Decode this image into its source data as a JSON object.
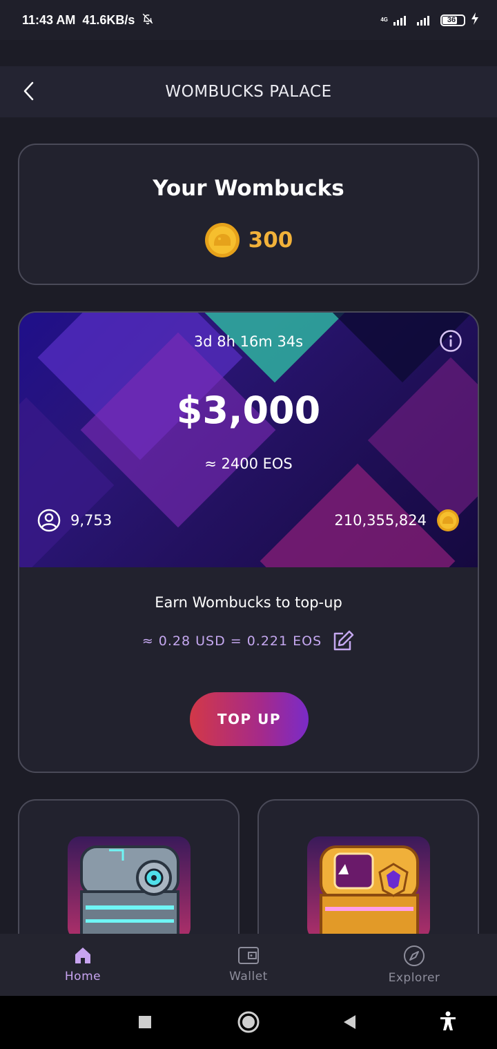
{
  "status_bar": {
    "time": "11:43 AM",
    "speed": "41.6KB/s",
    "network_label": "4G",
    "battery": "36"
  },
  "header": {
    "title": "WOMBUCKS PALACE"
  },
  "wombucks": {
    "title": "Your Wombucks",
    "value": "300"
  },
  "prize": {
    "timer": "3d 8h 16m 34s",
    "amount": "$3,000",
    "eos": "≈ 2400 EOS",
    "players": "9,753",
    "pool": "210,355,824",
    "earn_text": "Earn Wombucks to top-up",
    "rate": "≈ 0.28 USD = 0.221 EOS",
    "button_label": "TOP UP"
  },
  "colors": {
    "background": "#1c1c26",
    "accent": "#c8a4f0",
    "coin": "#f2b23a",
    "button_start": "#d23848",
    "button_end": "#7a2bc8"
  },
  "nav": {
    "items": [
      {
        "label": "Home",
        "icon": "home-icon",
        "active": true
      },
      {
        "label": "Wallet",
        "icon": "wallet-icon",
        "active": false
      },
      {
        "label": "Explorer",
        "icon": "compass-icon",
        "active": false
      }
    ]
  }
}
